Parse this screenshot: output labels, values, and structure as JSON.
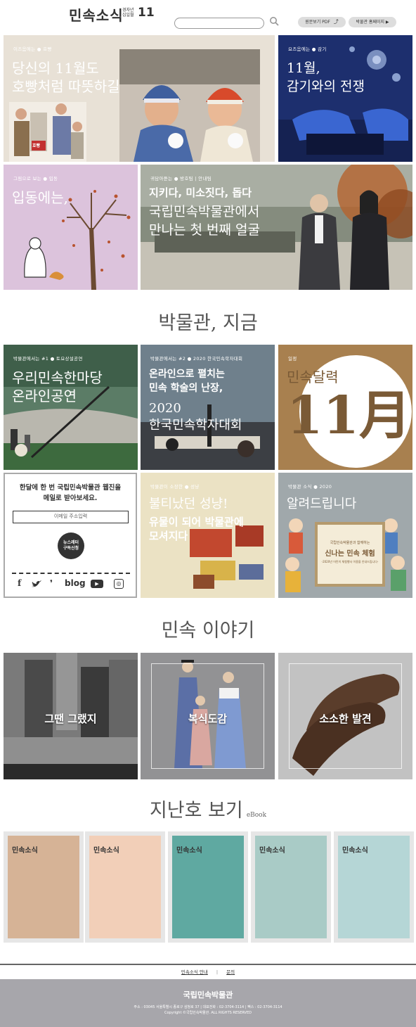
{
  "header": {
    "logo": "민속소식",
    "issue_year": "경자년",
    "issue_month_label": "십일월",
    "issue_number": "11",
    "search_placeholder": "",
    "pdf_button": "원문보기 PDF",
    "homepage_button": "박물관 홈페이지 ▶"
  },
  "features": [
    {
      "tag": "이즈음에는 ● 호빵",
      "title_line1": "당신의 11월도",
      "title_line2": "호빵처럼 따뜻하길",
      "badge": "호빵"
    },
    {
      "tag": "요즈음에는 ● 감기",
      "title_line1": "11월,",
      "title_line2": "감기와의 전쟁"
    },
    {
      "tag": "그림으로 보는 ● 입동",
      "title_line1": "입동에는,"
    },
    {
      "tag": "귀담아듣는 ● 방호팀 | 안내팀",
      "subtitle": "지키다, 미소짓다, 돕다",
      "title_line1": "국립민속박물관에서",
      "title_line2": "만나는 첫 번째 얼굴"
    }
  ],
  "section_now": {
    "title": "박물관, 지금",
    "tiles": [
      {
        "tag": "박물관에서는 #1 ● 토요상설공연",
        "title_line1": "우리민속한마당",
        "title_line2": "온라인공연"
      },
      {
        "tag": "박물관에서는 #2 ● 2020 한국민속학자대회",
        "subtitle_line1": "온라인으로 펼치는",
        "subtitle_line2": "민속 학술의 난장,",
        "title_line1": "2020",
        "title_line2": "한국민속학자대회"
      },
      {
        "tag": "일정",
        "title_line1": "민속달력",
        "big": "11月"
      },
      {
        "tag": "박물관이 소장한 ● 성냥",
        "title_line1": "불티났던 성냥!",
        "title_line2": "유물이 되어 박물관에",
        "title_line3": "모셔지다"
      },
      {
        "tag": "박물관 소식 ● 2020",
        "title_line1": "알려드립니다",
        "scroll_small": "국립민속박물관과 함께하는",
        "scroll_big": "신나는 민속 체험",
        "scroll_note": "-2020년 어린이 체험행사 이용을 안내드립니다-"
      }
    ]
  },
  "newsletter": {
    "text_line1": "한달에 한 번 국립민속박물관 웹진을",
    "text_line2": "메일로 받아보세요.",
    "email_placeholder": "이메일 주소입력",
    "subscribe_line1": "뉴스레터",
    "subscribe_line2": "구독신청",
    "social": {
      "facebook": "f",
      "twitter": "🐦",
      "kakao": "❜",
      "blog": "blog",
      "youtube": "▶",
      "instagram": "◎"
    }
  },
  "section_story": {
    "title": "민속 이야기",
    "tiles": [
      {
        "label": "그땐 그랬지"
      },
      {
        "label": "복식도감"
      },
      {
        "label": "소소한 발견"
      }
    ]
  },
  "section_archive": {
    "title": "지난호 보기",
    "suffix": "eBook",
    "ebook_title": "민속소식",
    "colors": [
      "#d6b396",
      "#f2cfb8",
      "#5fa9a1",
      "#a9cbc6",
      "#b5d6d6"
    ]
  },
  "footer": {
    "link_about": "민속소식 안내",
    "link_separator": "|",
    "link_contact": "문의",
    "org_name": "국립민속박물관",
    "address": "주소 : 03045 서울특별시 종로구 삼청로 37 | 대표전화 : 02-3704-3114 | 팩스 : 02-3704-3114",
    "copyright": "Copyright ©국립민속박물관. ALL RIGHTS RESERVED"
  }
}
